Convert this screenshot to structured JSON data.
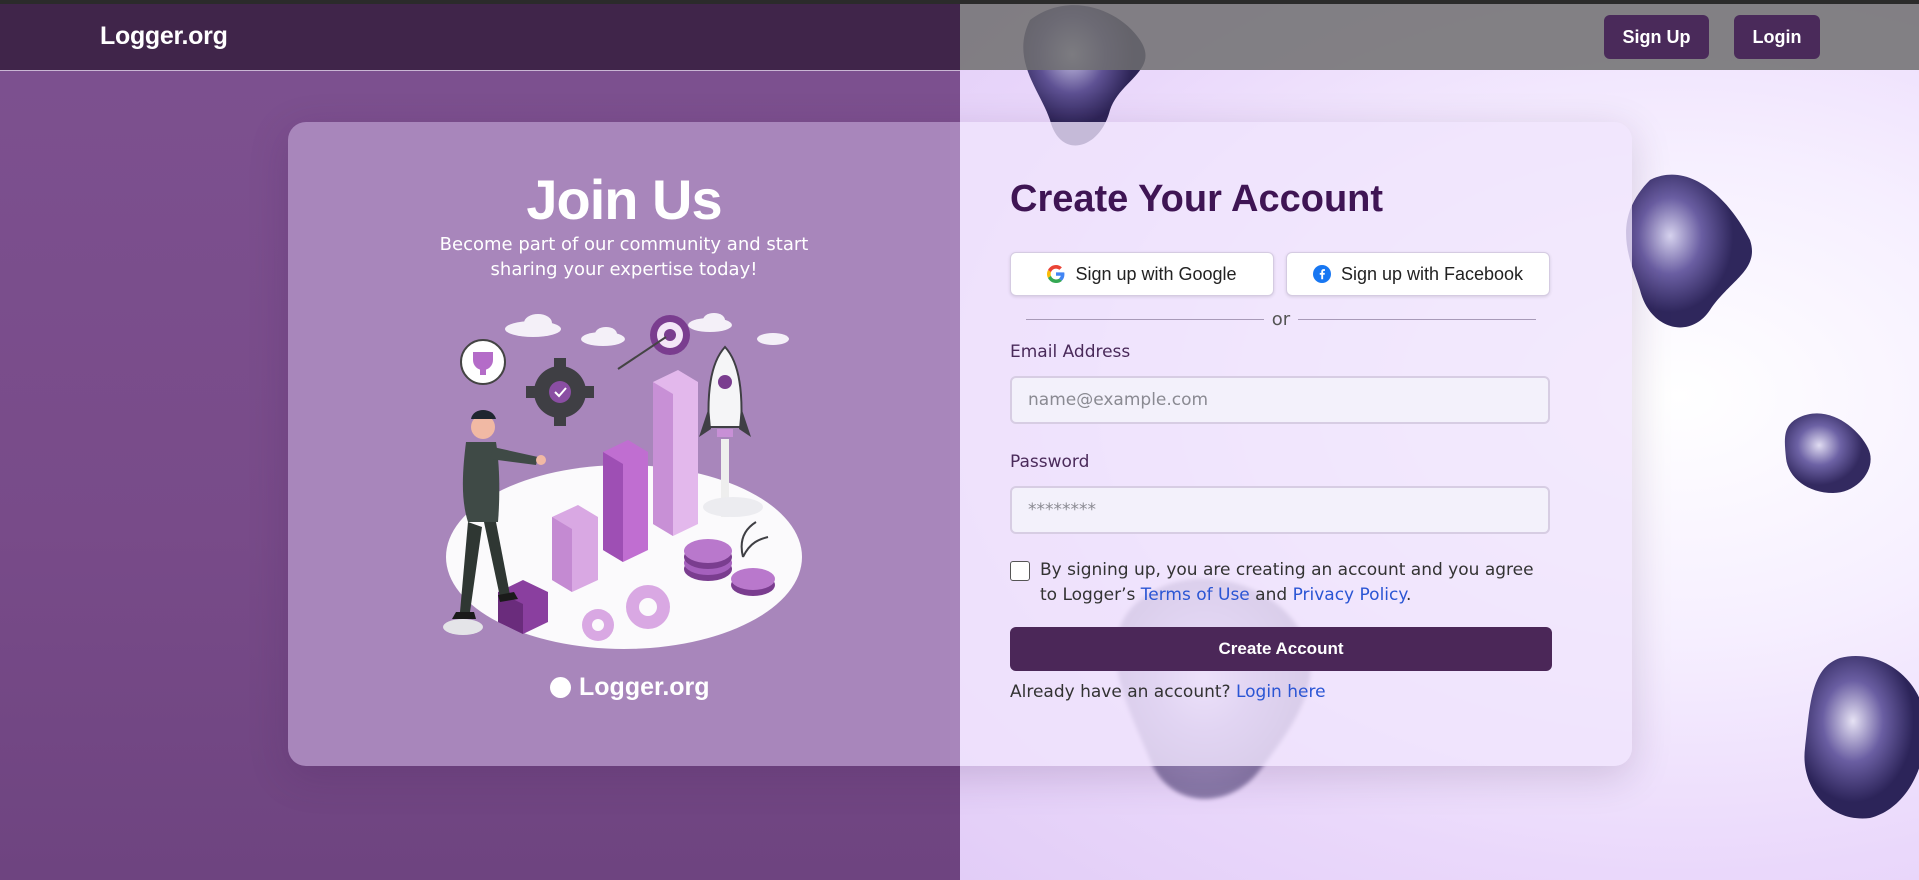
{
  "navbar": {
    "brand": "Logger.org",
    "signup_label": "Sign Up",
    "login_label": "Login"
  },
  "promo": {
    "title": "Join Us",
    "subtitle": "Become part of our community and start sharing your expertise today!",
    "logo_text": "Logger.org",
    "illustration_icon": "growth-illustration"
  },
  "form": {
    "title": "Create Your Account",
    "google_label": "Sign up with Google",
    "facebook_label": "Sign up with Facebook",
    "divider_text": "or",
    "email_label": "Email Address",
    "email_placeholder": "name@example.com",
    "email_value": "",
    "password_label": "Password",
    "password_placeholder": "********",
    "password_value": "",
    "terms_prefix": "By signing up, you are creating an account and you agree to Logger’s",
    "terms_link": "Terms of Use",
    "terms_and": "and",
    "privacy_link": "Privacy Policy",
    "terms_suffix": ".",
    "terms_checked": false,
    "submit_label": "Create Account",
    "already_text": "Already have an account?",
    "login_link": "Login here"
  },
  "colors": {
    "brand_dark": "#40254a",
    "primary_button": "#4b2758",
    "heading": "#3f1554",
    "link": "#2a55d4",
    "promo_panel": "#a886bb"
  }
}
